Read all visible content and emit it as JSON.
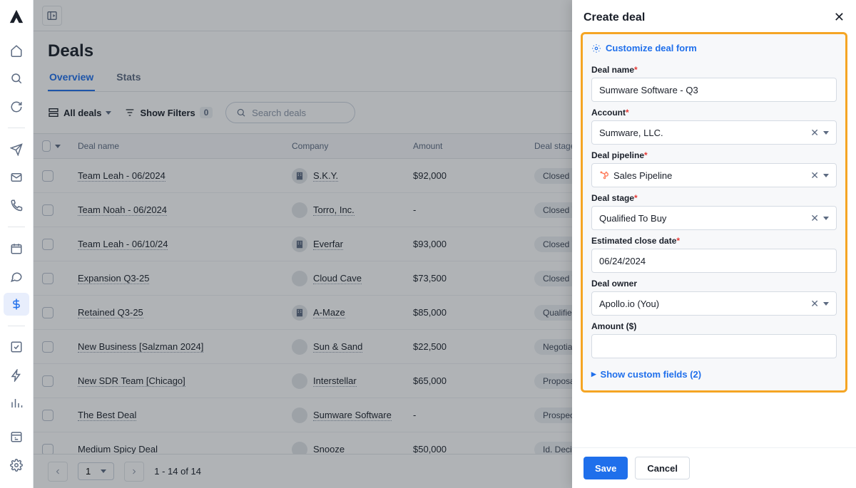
{
  "page_title": "Deals",
  "tabs": {
    "overview": "Overview",
    "stats": "Stats"
  },
  "toolbar": {
    "all_deals": "All deals",
    "show_filters": "Show Filters",
    "filter_count": "0",
    "search_placeholder": "Search deals"
  },
  "table": {
    "headers": {
      "name": "Deal name",
      "company": "Company",
      "amount": "Amount",
      "stage": "Deal stage"
    },
    "rows": [
      {
        "name": "Team Leah - 06/2024",
        "company": "S.K.Y.",
        "company_icon": "building",
        "amount": "$92,000",
        "stage": "Closed Lost"
      },
      {
        "name": "Team Noah - 06/2024",
        "company": "Torro, Inc.",
        "company_icon": "avatar",
        "amount": "-",
        "stage": "Closed Won"
      },
      {
        "name": "Team Leah - 06/10/24",
        "company": "Everfar",
        "company_icon": "building",
        "amount": "$93,000",
        "stage": "Closed Won"
      },
      {
        "name": "Expansion Q3-25",
        "company": "Cloud Cave",
        "company_icon": "avatar",
        "amount": "$73,500",
        "stage": "Closed Won"
      },
      {
        "name": "Retained Q3-25",
        "company": "A-Maze",
        "company_icon": "building",
        "amount": "$85,000",
        "stage": "Qualified To Bu"
      },
      {
        "name": "New Business [Salzman 2024]",
        "company": "Sun & Sand",
        "company_icon": "avatar",
        "amount": "$22,500",
        "stage": "Negotiation/Rev"
      },
      {
        "name": "New SDR Team [Chicago]",
        "company": "Interstellar",
        "company_icon": "avatar",
        "amount": "$65,000",
        "stage": "Proposal/Price"
      },
      {
        "name": "The Best Deal",
        "company": "Sumware Software",
        "company_icon": "avatar",
        "amount": "-",
        "stage": "Prospecting"
      },
      {
        "name": "Medium Spicy Deal",
        "company": "Snooze",
        "company_icon": "avatar",
        "amount": "$50,000",
        "stage": "Id. Decision Ma"
      }
    ]
  },
  "pager": {
    "page": "1",
    "range": "1 - 14 of 14"
  },
  "panel": {
    "title": "Create deal",
    "customize": "Customize deal form",
    "labels": {
      "deal_name": "Deal name",
      "account": "Account",
      "pipeline": "Deal pipeline",
      "stage": "Deal stage",
      "close_date": "Estimated close date",
      "owner": "Deal owner",
      "amount": "Amount ($)"
    },
    "values": {
      "deal_name": "Sumware Software - Q3",
      "account": "Sumware, LLC.",
      "pipeline": "Sales Pipeline",
      "stage": "Qualified To Buy",
      "close_date": "06/24/2024",
      "owner": "Apollo.io (You)",
      "amount": ""
    },
    "show_custom": "Show custom fields (2)",
    "save": "Save",
    "cancel": "Cancel"
  }
}
